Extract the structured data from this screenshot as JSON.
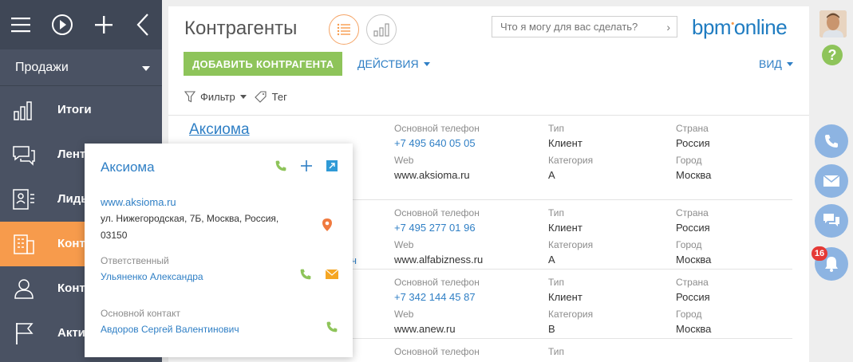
{
  "sidebar": {
    "workplace": "Продажи",
    "items": [
      {
        "label": "Итоги",
        "icon": "dashboard-icon"
      },
      {
        "label": "Лента",
        "icon": "feed-icon"
      },
      {
        "label": "Лиды",
        "icon": "leads-icon"
      },
      {
        "label": "Контрагенты",
        "icon": "accounts-icon"
      },
      {
        "label": "Контакты",
        "icon": "contacts-icon"
      },
      {
        "label": "Активности",
        "icon": "activities-icon"
      }
    ]
  },
  "header": {
    "title": "Контрагенты",
    "search_placeholder": "Что я могу для вас сделать?",
    "logo_main": "bpm",
    "logo_suffix": "online",
    "add_button": "ДОБАВИТЬ КОНТРАГЕНТА",
    "actions_button": "ДЕЙСТВИЯ",
    "view_button": "ВИД",
    "filter_label": "Фильтр",
    "tag_label": "Тег"
  },
  "list": {
    "labels": {
      "phone": "Основной телефон",
      "web": "Web",
      "type": "Тип",
      "category": "Категория",
      "country": "Страна",
      "city": "Город"
    },
    "rows": [
      {
        "name": "Аксиома",
        "phone": "+7 495 640 05 05",
        "web": "www.aksioma.ru",
        "type": "Клиент",
        "category": "A",
        "country": "Россия",
        "city": "Москва"
      },
      {
        "name": "",
        "phone": "+7 495 277 01 96",
        "web": "www.alfabizness.ru",
        "type": "Клиент",
        "category": "A",
        "country": "Россия",
        "city": "Москва",
        "peek": "ич"
      },
      {
        "name": "",
        "phone": "+7 342 144 45 87",
        "web": "www.anew.ru",
        "type": "Клиент",
        "category": "B",
        "country": "Россия",
        "city": "Москва"
      },
      {
        "name": "",
        "phone": "",
        "web": "",
        "type": "",
        "category": "",
        "country": "",
        "city": ""
      }
    ]
  },
  "popup": {
    "title": "Аксиома",
    "website": "www.aksioma.ru",
    "address_line1": "ул. Нижегородская, 7Б, Москва, Россия,",
    "address_line2": "03150",
    "owner_label": "Ответственный",
    "owner": "Ульяненко Александра",
    "contact_label": "Основной контакт",
    "contact": "Авдоров Сергей Валентинович"
  },
  "right_panel": {
    "help": "?",
    "notifications_count": "16"
  },
  "colors": {
    "sidebar_bg": "#4a5263",
    "active_item": "#f79b4c",
    "accent_green": "#8ec45a",
    "link_blue": "#2f7fc5",
    "comm_blue": "#8db4e2",
    "badge_red": "#e53935"
  }
}
